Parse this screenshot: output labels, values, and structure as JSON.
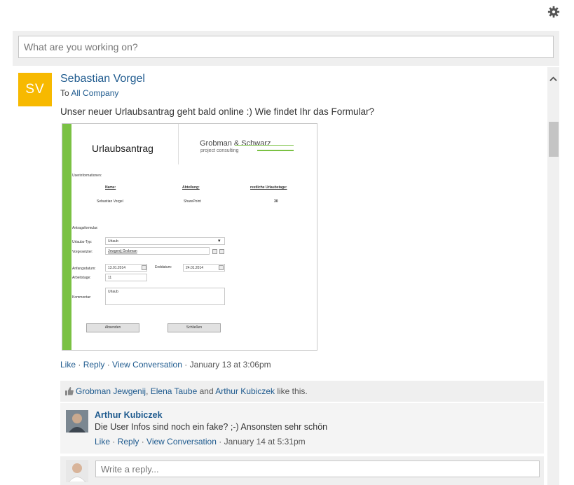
{
  "settings": {
    "icon": "gear-icon"
  },
  "publisher": {
    "placeholder": "What are you working on?"
  },
  "post": {
    "avatar_initials": "SV",
    "avatar_color": "#f7b900",
    "author": "Sebastian Vorgel",
    "audience_prefix": "To",
    "audience": "All Company",
    "text": "Unser neuer Urlaubsantrag geht bald online :) Wie findet Ihr das Formular?",
    "attachment": {
      "title": "Urlaubsantrag",
      "logo_name": "Grobman & Schwarz",
      "logo_sub": "project consulting",
      "section_user": "Userinformationen:",
      "col_name": "Name:",
      "col_dept": "Abteilung:",
      "col_days": "restliche Urlaubstage:",
      "val_name": "Sebastian Vorgel",
      "val_dept": "SharePoint",
      "val_days": "30",
      "section_form": "Antragsformular:",
      "type_label": "Urlaubs-Typ:",
      "type_value": "Urlaub",
      "super_label": "Vorgesetzter:",
      "super_value": "Jewgenij Grobman",
      "start_label": "Anfangsdatum:",
      "start_value": "13.01.2014",
      "end_label": "Enddatum:",
      "end_value": "24.01.2014",
      "days_label": "Arbeitstage:",
      "days_value": "11",
      "comment_label": "Kommentar:",
      "comment_value": "Urlaub",
      "submit": "Absenden",
      "close": "Schließen"
    },
    "actions": {
      "like": "Like",
      "reply": "Reply",
      "view": "View Conversation",
      "timestamp": "January 13 at 3:06pm"
    },
    "likes": {
      "person1": "Grobman Jewgenij",
      "person2": "Elena Taube",
      "and": "and",
      "person3": "Arthur Kubiczek",
      "suffix": "like this."
    }
  },
  "reply": {
    "author": "Arthur Kubiczek",
    "text": "Die User Infos sind noch ein fake? ;-) Ansonsten sehr schön",
    "like": "Like",
    "reply": "Reply",
    "view": "View Conversation",
    "timestamp": "January 14 at 5:31pm"
  },
  "composer": {
    "placeholder": "Write a reply..."
  }
}
